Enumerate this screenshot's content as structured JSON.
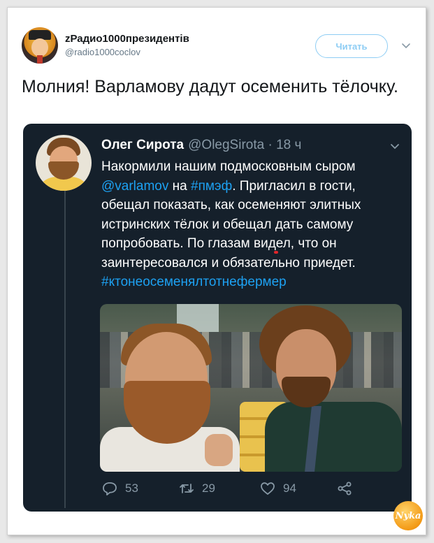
{
  "outer_tweet": {
    "display_name": "zРадио1000президентів",
    "handle": "@radio1000coclov",
    "follow_label": "Читать",
    "text": "Молния! Варламову дадут осеменить тёлочку."
  },
  "quoted_tweet": {
    "display_name": "Олег Сирота",
    "handle": "@OlegSirota",
    "separator": "·",
    "time": "18 ч",
    "text_1": "Накормили нашим подмосковным сыром ",
    "mention": "@varlamov",
    "text_2": " на ",
    "hashtag_1": "#пмэф",
    "text_3": ". Пригласил в гости, обещал показать, как осеменяют элитных истринских тёлок и обещал ",
    "highlight": "дать самому попробовать",
    "text_4": ". По глазам видел, что он заинтересовался и обязательно приедет. ",
    "hashtag_2": "#ктонеосеменялтотнефермер",
    "replies": "53",
    "retweets": "29",
    "likes": "94"
  },
  "watermark": "Nyka",
  "colors": {
    "dark_bg": "#15202b",
    "link": "#1da1f2",
    "highlight_underline": "#e0262a",
    "follow_outline": "#8ecdf4"
  },
  "icons": [
    "chevron-down-icon",
    "reply-icon",
    "retweet-icon",
    "like-icon",
    "share-icon"
  ]
}
